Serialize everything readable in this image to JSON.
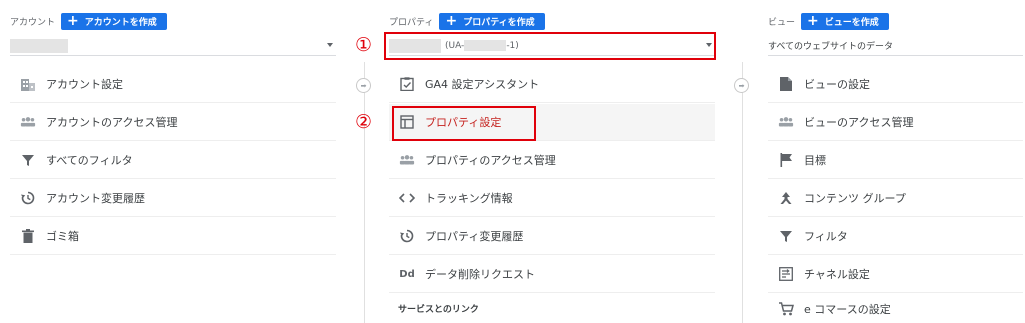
{
  "account": {
    "label": "アカウント",
    "create_button": "アカウントを作成",
    "items": [
      {
        "icon": "building-icon",
        "label": "アカウント設定"
      },
      {
        "icon": "people-icon",
        "label": "アカウントのアクセス管理"
      },
      {
        "icon": "filter-icon",
        "label": "すべてのフィルタ"
      },
      {
        "icon": "history-icon",
        "label": "アカウント変更履歴"
      },
      {
        "icon": "trash-icon",
        "label": "ゴミ箱"
      }
    ]
  },
  "property": {
    "label": "プロパティ",
    "create_button": "プロパティを作成",
    "selector_prefix": "(UA-",
    "selector_suffix": "-1)",
    "items": [
      {
        "icon": "checklist-icon",
        "label": "GA4 設定アシスタント"
      },
      {
        "icon": "layout-icon",
        "label": "プロパティ設定"
      },
      {
        "icon": "people-icon",
        "label": "プロパティのアクセス管理"
      },
      {
        "icon": "code-icon",
        "label": "トラッキング情報"
      },
      {
        "icon": "history-icon",
        "label": "プロパティ変更履歴"
      },
      {
        "icon": "dd-icon",
        "label": "データ削除リクエスト",
        "glyph": "Dd"
      }
    ],
    "section_title": "サービスとのリンク"
  },
  "view": {
    "label": "ビュー",
    "create_button": "ビューを作成",
    "selector_value": "すべてのウェブサイトのデータ",
    "items": [
      {
        "icon": "document-icon",
        "label": "ビューの設定"
      },
      {
        "icon": "people-icon",
        "label": "ビューのアクセス管理"
      },
      {
        "icon": "flag-icon",
        "label": "目標"
      },
      {
        "icon": "content-group-icon",
        "label": "コンテンツ グループ"
      },
      {
        "icon": "filter-icon",
        "label": "フィルタ"
      },
      {
        "icon": "channel-icon",
        "label": "チャネル設定"
      },
      {
        "icon": "cart-icon",
        "label": "e コマースの設定"
      }
    ]
  },
  "annotations": {
    "marker_1": "①",
    "marker_2": "②",
    "color": "#e0000a"
  },
  "colors": {
    "accent": "#1a73e8",
    "active_text": "#c5221f"
  }
}
